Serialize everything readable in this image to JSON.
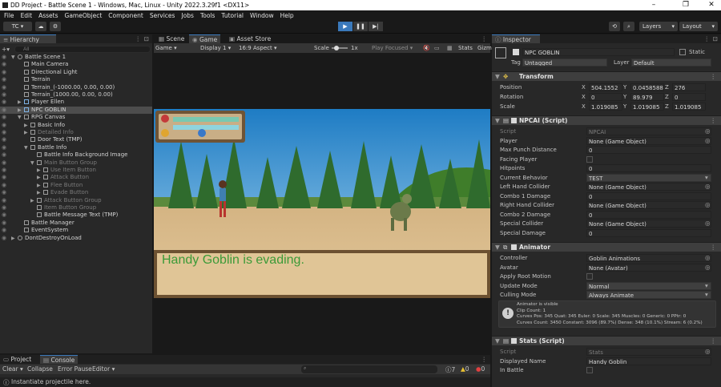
{
  "window": {
    "title": "DD Project - Battle Scene 1 - Windows, Mac, Linux - Unity 2022.3.29f1 <DX11>",
    "min": "–",
    "max": "❐",
    "close": "✕"
  },
  "menu": [
    "File",
    "Edit",
    "Assets",
    "GameObject",
    "Component",
    "Services",
    "Jobs",
    "Tools",
    "Tutorial",
    "Window",
    "Help"
  ],
  "toolbar": {
    "account": "TC ▾",
    "layers": "Layers",
    "layout": "Layout"
  },
  "hierarchy": {
    "tab": "Hierarchy",
    "search_placeholder": "All",
    "items": [
      {
        "label": "Battle Scene 1",
        "indent": 0,
        "dim": false,
        "sel": false,
        "arrow": "▼",
        "icon": "unity"
      },
      {
        "label": "Main Camera",
        "indent": 1,
        "dim": false,
        "sel": false,
        "arrow": "",
        "icon": "cube"
      },
      {
        "label": "Directional Light",
        "indent": 1,
        "dim": false,
        "sel": false,
        "arrow": "",
        "icon": "cube"
      },
      {
        "label": "Terrain",
        "indent": 1,
        "dim": false,
        "sel": false,
        "arrow": "",
        "icon": "cube"
      },
      {
        "label": "Terrain_(-1000.00, 0.00, 0.00)",
        "indent": 1,
        "dim": false,
        "sel": false,
        "arrow": "",
        "icon": "cube"
      },
      {
        "label": "Terrain_(1000.00, 0.00, 0.00)",
        "indent": 1,
        "dim": false,
        "sel": false,
        "arrow": "",
        "icon": "cube"
      },
      {
        "label": "Player Ellen",
        "indent": 1,
        "dim": false,
        "sel": false,
        "arrow": "▶",
        "icon": "blue"
      },
      {
        "label": "NPC GOBLIN",
        "indent": 1,
        "dim": false,
        "sel": true,
        "arrow": "▶",
        "icon": "blue"
      },
      {
        "label": "RPG Canvas",
        "indent": 1,
        "dim": false,
        "sel": false,
        "arrow": "▼",
        "icon": "cube"
      },
      {
        "label": "Basic Info",
        "indent": 2,
        "dim": false,
        "sel": false,
        "arrow": "▶",
        "icon": "cube"
      },
      {
        "label": "Detailed Info",
        "indent": 2,
        "dim": true,
        "sel": false,
        "arrow": "▶",
        "icon": "cube"
      },
      {
        "label": "Door Text (TMP)",
        "indent": 2,
        "dim": false,
        "sel": false,
        "arrow": "",
        "icon": "cube"
      },
      {
        "label": "Battle Info",
        "indent": 2,
        "dim": false,
        "sel": false,
        "arrow": "▼",
        "icon": "cube"
      },
      {
        "label": "Battle Info Background Image",
        "indent": 3,
        "dim": false,
        "sel": false,
        "arrow": "",
        "icon": "cube"
      },
      {
        "label": "Main Button Group",
        "indent": 3,
        "dim": true,
        "sel": false,
        "arrow": "▼",
        "icon": "cube"
      },
      {
        "label": "Use Item Button",
        "indent": 4,
        "dim": true,
        "sel": false,
        "arrow": "▶",
        "icon": "cube"
      },
      {
        "label": "Attack Button",
        "indent": 4,
        "dim": true,
        "sel": false,
        "arrow": "▶",
        "icon": "cube"
      },
      {
        "label": "Flee Button",
        "indent": 4,
        "dim": true,
        "sel": false,
        "arrow": "▶",
        "icon": "cube"
      },
      {
        "label": "Evade Button",
        "indent": 4,
        "dim": true,
        "sel": false,
        "arrow": "▶",
        "icon": "cube"
      },
      {
        "label": "Attack Button Group",
        "indent": 3,
        "dim": true,
        "sel": false,
        "arrow": "▶",
        "icon": "cube"
      },
      {
        "label": "Item Button Group",
        "indent": 3,
        "dim": true,
        "sel": false,
        "arrow": "",
        "icon": "cube"
      },
      {
        "label": "Battle Message Text (TMP)",
        "indent": 3,
        "dim": false,
        "sel": false,
        "arrow": "",
        "icon": "cube"
      },
      {
        "label": "Battle Manager",
        "indent": 1,
        "dim": false,
        "sel": false,
        "arrow": "",
        "icon": "cube"
      },
      {
        "label": "EventSystem",
        "indent": 1,
        "dim": false,
        "sel": false,
        "arrow": "",
        "icon": "cube"
      },
      {
        "label": "DontDestroyOnLoad",
        "indent": 0,
        "dim": false,
        "sel": false,
        "arrow": "▶",
        "icon": "unity"
      }
    ]
  },
  "center": {
    "tabs": [
      "Scene",
      "Game",
      "Asset Store"
    ],
    "gamebar": {
      "mode": "Game ▾",
      "display": "Display 1 ▾",
      "aspect": "16:9 Aspect ▾",
      "scale_label": "Scale",
      "scale_value": "1x",
      "play_focused": "Play Focused ▾",
      "stats": "Stats",
      "gizmos": "Gizmos"
    },
    "battle_message": "Handy Goblin is evading."
  },
  "inspector": {
    "tab": "Inspector",
    "object_name": "NPC GOBLIN",
    "static": "Static",
    "tag_label": "Tag",
    "tag_value": "Untagged",
    "layer_label": "Layer",
    "layer_value": "Default",
    "transform": {
      "title": "Transform",
      "position": {
        "label": "Position",
        "x": "504.1552",
        "y": "0.04585886",
        "z": "276"
      },
      "rotation": {
        "label": "Rotation",
        "x": "0",
        "y": "89.979",
        "z": "0"
      },
      "scale": {
        "label": "Scale",
        "x": "1.019085",
        "y": "1.019085",
        "z": "1.019085"
      }
    },
    "npcai": {
      "title": "NPCAI (Script)",
      "fields": [
        {
          "label": "Script",
          "value": "NPCAI",
          "kind": "ref",
          "dim": true
        },
        {
          "label": "Player",
          "value": "None (Game Object)",
          "kind": "ref",
          "dim": false
        },
        {
          "label": "Max Punch Distance",
          "value": "0",
          "kind": "num",
          "dim": false
        },
        {
          "label": "Facing Player",
          "value": "",
          "kind": "check",
          "dim": false
        },
        {
          "label": "Hitpoints",
          "value": "0",
          "kind": "num",
          "dim": false
        },
        {
          "label": "Current Behavior",
          "value": "TEST",
          "kind": "drop",
          "dim": false
        },
        {
          "label": "Left Hand Collider",
          "value": "None (Game Object)",
          "kind": "ref",
          "dim": false
        },
        {
          "label": "Combo 1 Damage",
          "value": "0",
          "kind": "num",
          "dim": false
        },
        {
          "label": "Right Hand Collider",
          "value": "None (Game Object)",
          "kind": "ref",
          "dim": false
        },
        {
          "label": "Combo 2 Damage",
          "value": "0",
          "kind": "num",
          "dim": false
        },
        {
          "label": "Special Collider",
          "value": "None (Game Object)",
          "kind": "ref",
          "dim": false
        },
        {
          "label": "Special Damage",
          "value": "0",
          "kind": "num",
          "dim": false
        }
      ]
    },
    "animator": {
      "title": "Animator",
      "fields": [
        {
          "label": "Controller",
          "value": "Goblin Animations",
          "kind": "ref"
        },
        {
          "label": "Avatar",
          "value": "None (Avatar)",
          "kind": "ref"
        },
        {
          "label": "Apply Root Motion",
          "value": "",
          "kind": "check"
        },
        {
          "label": "Update Mode",
          "value": "Normal",
          "kind": "drop"
        },
        {
          "label": "Culling Mode",
          "value": "Always Animate",
          "kind": "drop"
        }
      ],
      "info": [
        "Animator is visible",
        "Clip Count: 1",
        "Curves Pos: 345 Quat: 345 Euler: 0 Scale: 345 Muscles: 0 Generic: 0 PPtr: 0",
        "Curves Count: 3450 Constant: 3096 (89.7%) Dense: 348 (10.1%) Stream: 6 (0.2%)"
      ]
    },
    "stats": {
      "title": "Stats (Script)",
      "fields": [
        {
          "label": "Script",
          "value": "Stats",
          "kind": "ref",
          "dim": true
        },
        {
          "label": "Displayed Name",
          "value": "Handy Goblin",
          "kind": "text",
          "dim": false
        },
        {
          "label": "In Battle",
          "value": "",
          "kind": "check",
          "dim": false
        }
      ]
    }
  },
  "console": {
    "tabs": [
      "Project",
      "Console"
    ],
    "buttons": [
      "Clear ▾",
      "Collapse",
      "Error Pause",
      "Editor ▾"
    ],
    "counts": {
      "log": "7",
      "warn": "0",
      "error": "0"
    },
    "status": "Instantiate projectile here."
  }
}
